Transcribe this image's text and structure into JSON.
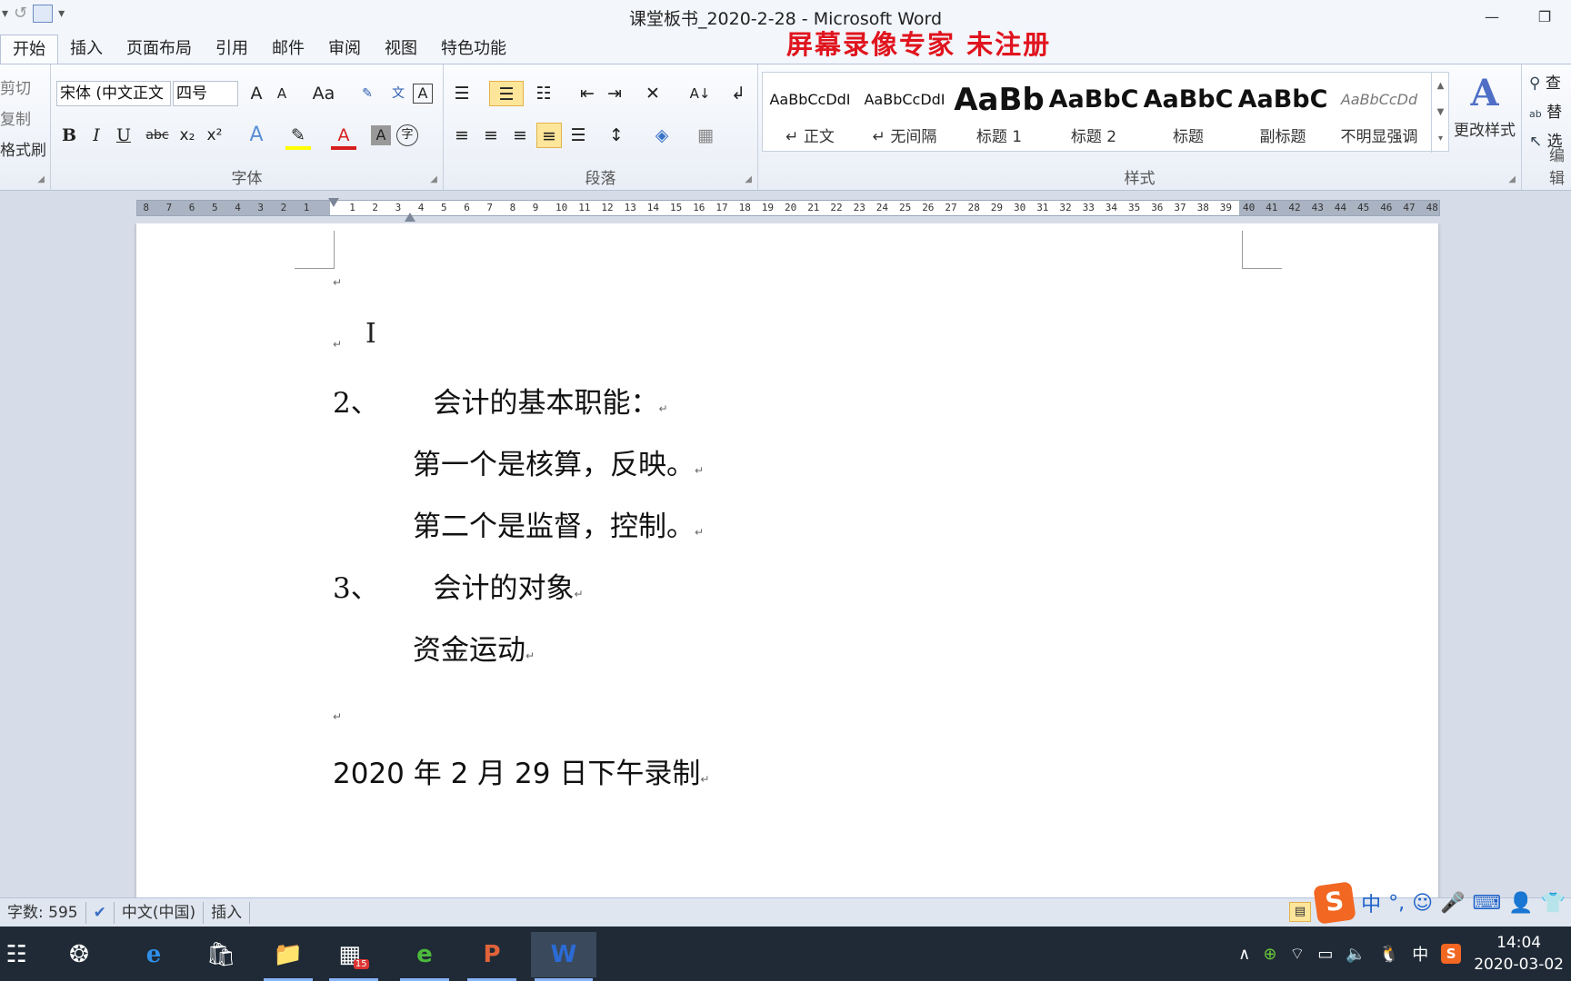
{
  "window": {
    "title": "课堂板书_2020-2-28 - Microsoft Word",
    "watermark": "屏幕录像专家 未注册"
  },
  "tabs": [
    "开始",
    "插入",
    "页面布局",
    "引用",
    "邮件",
    "审阅",
    "视图",
    "特色功能"
  ],
  "ribbon": {
    "clipboard": {
      "cut": "剪切",
      "copy": "复制",
      "format_painter": "格式刷"
    },
    "font": {
      "label": "字体",
      "font_name": "宋体 (中文正文",
      "font_size": "四号",
      "grow": "A",
      "shrink": "A",
      "case": "Aa",
      "bold": "B",
      "italic": "I",
      "underline": "U",
      "strike": "abc",
      "sub": "x₂",
      "sup": "x²",
      "text_effect": "A",
      "highlight": "✎",
      "font_color": "A",
      "char_shade": "A",
      "enclose": "字"
    },
    "paragraph": {
      "label": "段落"
    },
    "styles": {
      "label": "样式",
      "items": [
        {
          "sample": "AaBbCcDdI",
          "name": "↵ 正文"
        },
        {
          "sample": "AaBbCcDdI",
          "name": "↵ 无间隔"
        },
        {
          "sample": "AaBb",
          "name": "标题 1"
        },
        {
          "sample": "AaBbC",
          "name": "标题 2"
        },
        {
          "sample": "AaBbC",
          "name": "标题"
        },
        {
          "sample": "AaBbC",
          "name": "副标题"
        },
        {
          "sample": "AaBbCcDd",
          "name": "不明显强调"
        }
      ],
      "change_styles": "更改样式"
    },
    "editing": {
      "label": "编辑",
      "find": "查",
      "replace": "替",
      "select": "选"
    }
  },
  "ruler": {
    "left_numbers": [
      "8",
      "7",
      "6",
      "5",
      "4",
      "3",
      "2",
      "1"
    ],
    "right_numbers": [
      "1",
      "2",
      "3",
      "4",
      "5",
      "6",
      "7",
      "8",
      "9",
      "10",
      "11",
      "12",
      "13",
      "14",
      "15",
      "16",
      "17",
      "18",
      "19",
      "20",
      "21",
      "22",
      "23",
      "24",
      "25",
      "26",
      "27",
      "28",
      "29",
      "30",
      "31",
      "32",
      "33",
      "34",
      "35",
      "36",
      "37",
      "38",
      "39",
      "40",
      "41",
      "42",
      "43",
      "44",
      "45",
      "46",
      "47",
      "48"
    ]
  },
  "document": {
    "line1": "2、",
    "line1_text": "会计的基本职能：",
    "line2": "第一个是核算，反映。",
    "line3": "第二个是监督，控制。",
    "line4": "3、",
    "line4_text": "会计的对象",
    "line5": "资金运动",
    "line6": "2020 年 2 月 29 日下午录制",
    "para_mark": "↵",
    "cursor": "I"
  },
  "statusbar": {
    "word_count": "字数: 595",
    "language": "中文(中国)",
    "mode": "插入"
  },
  "ime": {
    "logo": "S",
    "mode": "中",
    "punct": "°,",
    "emoji": "☺",
    "mic": "🎤",
    "kbd": "⌨"
  },
  "taskbar": {
    "time": "14:04",
    "date": "2020-03-02",
    "ime_indicator": "中",
    "calendar_badge": "15"
  }
}
